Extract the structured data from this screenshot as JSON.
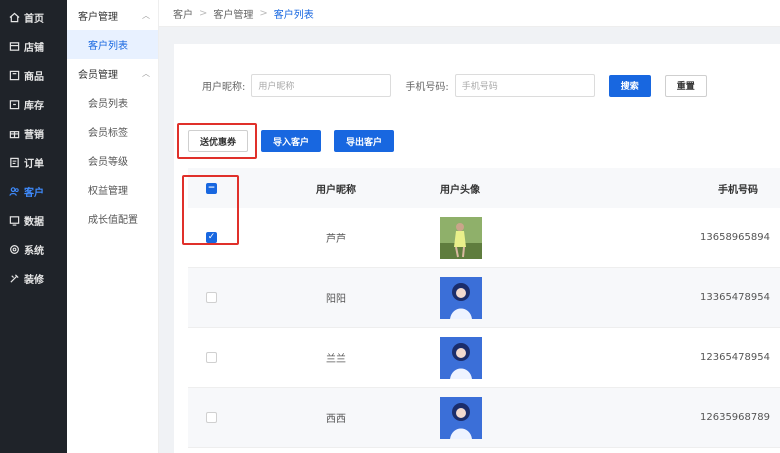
{
  "nav": [
    {
      "label": "首页",
      "icon": "home-icon"
    },
    {
      "label": "店铺",
      "icon": "store-icon"
    },
    {
      "label": "商品",
      "icon": "goods-icon"
    },
    {
      "label": "库存",
      "icon": "inventory-icon"
    },
    {
      "label": "营销",
      "icon": "gift-icon"
    },
    {
      "label": "订单",
      "icon": "order-icon"
    },
    {
      "label": "客户",
      "icon": "customer-icon"
    },
    {
      "label": "数据",
      "icon": "data-icon"
    },
    {
      "label": "系统",
      "icon": "settings-icon"
    },
    {
      "label": "装修",
      "icon": "decorate-icon"
    }
  ],
  "submenu": {
    "group1": "客户管理",
    "item_customer_list": "客户列表",
    "group2": "会员管理",
    "items": [
      "会员列表",
      "会员标签",
      "会员等级",
      "权益管理",
      "成长值配置"
    ]
  },
  "breadcrumb": {
    "a": "客户",
    "b": "客户管理",
    "c": "客户列表",
    "sep": ">"
  },
  "search": {
    "nickname_label": "用户昵称:",
    "nickname_placeholder": "用户昵称",
    "phone_label": "手机号码:",
    "phone_placeholder": "手机号码",
    "search_button": "搜索",
    "reset_button": "重置"
  },
  "actions": {
    "send_coupon": "送优惠券",
    "import": "导入客户",
    "export": "导出客户"
  },
  "table": {
    "headers": {
      "name": "用户昵称",
      "avatar": "用户头像",
      "phone": "手机号码"
    },
    "rows": [
      {
        "name": "芦芦",
        "phone": "13658965894",
        "checked": true
      },
      {
        "name": "阳阳",
        "phone": "13365478954",
        "checked": false
      },
      {
        "name": "兰兰",
        "phone": "12365478954",
        "checked": false
      },
      {
        "name": "西西",
        "phone": "12635968789",
        "checked": false
      }
    ]
  },
  "colors": {
    "primary": "#1867e0",
    "highlight": "#e0302a",
    "nav_bg": "#1f2329"
  }
}
